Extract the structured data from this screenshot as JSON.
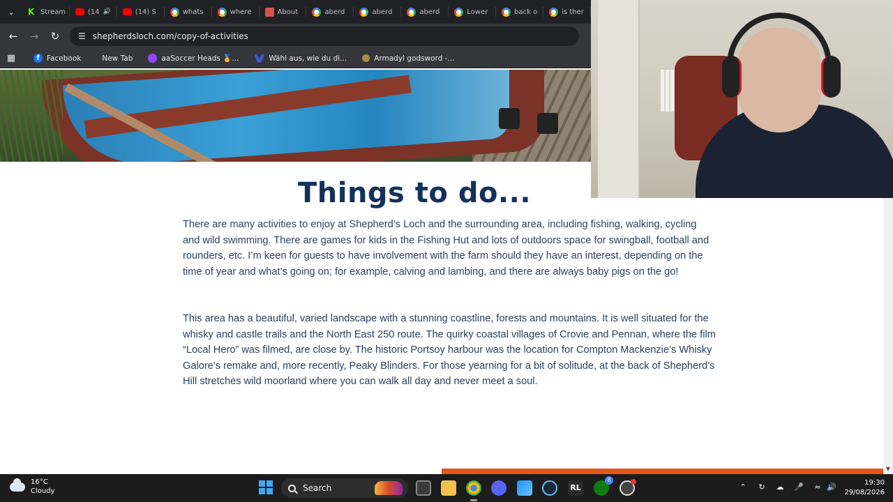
{
  "browser": {
    "tabs": [
      {
        "label": "Stream",
        "icon": "kick-icon"
      },
      {
        "label": "(14",
        "icon": "youtube-icon",
        "audio": true
      },
      {
        "label": "(14) S",
        "icon": "youtube-icon"
      },
      {
        "label": "whats",
        "icon": "google-icon"
      },
      {
        "label": "where",
        "icon": "google-icon"
      },
      {
        "label": "About",
        "icon": "site-icon"
      },
      {
        "label": "aberd",
        "icon": "google-icon"
      },
      {
        "label": "aberd",
        "icon": "google-icon"
      },
      {
        "label": "aberd",
        "icon": "google-icon"
      },
      {
        "label": "Lower",
        "icon": "google-icon"
      },
      {
        "label": "back o",
        "icon": "google-icon"
      },
      {
        "label": "is ther",
        "icon": "google-icon"
      }
    ],
    "url": "shepherdsloch.com/copy-of-activities",
    "bookmarks": [
      {
        "label": "Facebook"
      },
      {
        "label": "New Tab"
      },
      {
        "label": "aaSoccer Heads 🏅..."
      },
      {
        "label": "Wähl aus, wie du di..."
      },
      {
        "label": "Armadyl godsword -..."
      }
    ]
  },
  "page": {
    "title": "Things to do...",
    "paragraph1": "There are many activities to enjoy at Shepherd’s Loch and the surrounding area, including fishing, walking, cycling and wild swimming. There are games for kids in the Fishing Hut and lots of outdoors space for swingball, football and rounders, etc. I’m keen for guests to have involvement with the farm should they have an interest, depending on the time of year and what’s going on; for example, calving and lambing, and there are always baby pigs on the go!",
    "paragraph2": "This area has a beautiful, varied landscape with a stunning coastline, forests and mountains. It is well situated for the whisky and castle trails and the North East 250 route. The quirky coastal villages of Crovie and Pennan, where the film “Local Hero” was filmed, are close by. The historic Portsoy harbour was the location for Compton Mackenzie’s Whisky Galore's remake and, more recently, Peaky Blinders. For those yearning for a bit of solitude, at the back of Shepherd’s Hill stretches wild moorland where you can walk all day and never meet a soul.",
    "title_color": "#13325b",
    "text_color": "#2b3f5c",
    "progress_fraction": 0.5,
    "progress_color": "#e4571c"
  },
  "taskbar": {
    "temperature": "16°C",
    "condition": "Cloudy",
    "search_label": "Search",
    "time": "19:30",
    "date": "29/08/2026",
    "apps": [
      "chrome-icon",
      "discord-icon",
      "photos-icon",
      "steam-icon",
      "rocket-league-icon",
      "xbox-icon",
      "game-app-icon"
    ],
    "xbox_badge": "8"
  }
}
